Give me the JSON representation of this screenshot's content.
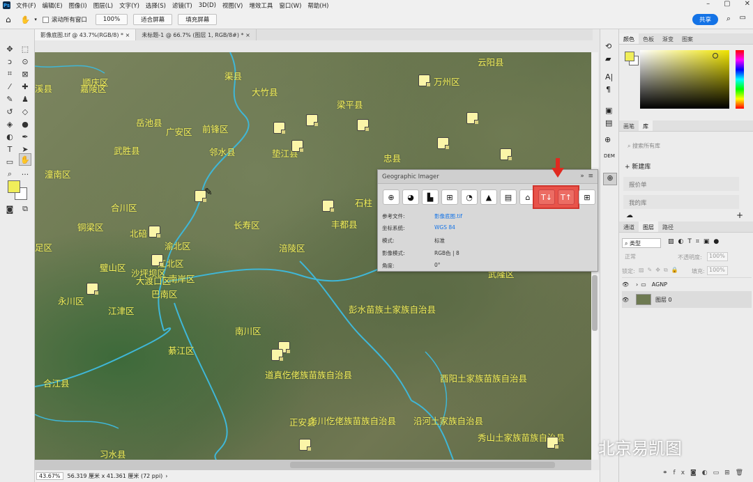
{
  "menubar": {
    "app_icon": "Ps",
    "items": [
      "文件(F)",
      "编辑(E)",
      "图像(I)",
      "图层(L)",
      "文字(Y)",
      "选择(S)",
      "滤镜(T)",
      "3D(D)",
      "视图(V)",
      "增效工具",
      "窗口(W)",
      "帮助(H)"
    ]
  },
  "options_bar": {
    "scroll_all_label": "滚动所有窗口",
    "zoom_100": "100%",
    "fit_screen": "适合屏幕",
    "fill_screen": "填充屏幕",
    "share": "共享"
  },
  "tabs": [
    {
      "label": "影像底图.tif @ 43.7%(RGB/8) *"
    },
    {
      "label": "未标题-1 @ 66.7% (图层 1, RGB/8#) *"
    }
  ],
  "map": {
    "labels": [
      {
        "text": "渠县"
      },
      {
        "text": "云阳县"
      },
      {
        "text": "顺庆区"
      },
      {
        "text": "嘉陵区"
      },
      {
        "text": "溪县"
      },
      {
        "text": "大竹县"
      },
      {
        "text": "万州区"
      },
      {
        "text": "梁平县"
      },
      {
        "text": "岳池县"
      },
      {
        "text": "广安区"
      },
      {
        "text": "前锋区"
      },
      {
        "text": "武胜县"
      },
      {
        "text": "邻水县"
      },
      {
        "text": "垫江县"
      },
      {
        "text": "忠县"
      },
      {
        "text": "潼南区"
      },
      {
        "text": "合川区"
      },
      {
        "text": "石柱"
      },
      {
        "text": "铜梁区"
      },
      {
        "text": "北碚"
      },
      {
        "text": "长寿区"
      },
      {
        "text": "丰都县"
      },
      {
        "text": "足区"
      },
      {
        "text": "渝北区"
      },
      {
        "text": "涪陵区"
      },
      {
        "text": "璧山区"
      },
      {
        "text": "沙坪坝区"
      },
      {
        "text": "江北区"
      },
      {
        "text": "大渡口区"
      },
      {
        "text": "南岸区"
      },
      {
        "text": "武隆区"
      },
      {
        "text": "永川区"
      },
      {
        "text": "巴南区"
      },
      {
        "text": "江津区"
      },
      {
        "text": "彭水苗族土家族自治县"
      },
      {
        "text": "南川区"
      },
      {
        "text": "綦江区"
      },
      {
        "text": "道真仡佬族苗族自治县"
      },
      {
        "text": "合江县"
      },
      {
        "text": "酉阳土家族苗族自治县"
      },
      {
        "text": "正安县"
      },
      {
        "text": "务川仡佬族苗族自治县"
      },
      {
        "text": "沿河土家族自治县"
      },
      {
        "text": "秀山土家族苗族自治县"
      },
      {
        "text": "习水县"
      }
    ]
  },
  "gi_panel": {
    "title": "Geographic Imager",
    "collapse": "»",
    "menu": "≡",
    "rows": [
      {
        "label": "参考文件:",
        "value": "影像底图.tif"
      },
      {
        "label": "坐标系统:",
        "value": "WGS 84"
      },
      {
        "label": "模式:",
        "value": "标准"
      },
      {
        "label": "影像模式:",
        "value": "RGB色 | 8"
      },
      {
        "label": "角度:",
        "value": "0°"
      }
    ],
    "buttons": [
      "target-icon",
      "globe-icon",
      "histogram-icon",
      "grid-icon",
      "reproject-icon",
      "mountain-icon",
      "table-icon",
      "building-icon",
      "import-text-icon",
      "export-text-icon",
      "add-frame-icon"
    ]
  },
  "status": {
    "zoom": "43.67%",
    "dims": "56.319 厘米 x 41.361 厘米 (72 ppi)"
  },
  "right_panel": {
    "color_tabs": [
      "颜色",
      "色板",
      "渐变",
      "图案"
    ],
    "lib_tabs": [
      "画笔",
      "库"
    ],
    "lib_search": "搜索所有库",
    "new_lib": "新建库",
    "libs": [
      "报价单",
      "我的库"
    ],
    "layer_tabs": [
      "通道",
      "图层",
      "路径"
    ],
    "filter": "类型",
    "blend": "正常",
    "opacity_label": "不透明度:",
    "opacity": "100%",
    "lock_label": "锁定:",
    "fill_label": "填充:",
    "fill": "100%",
    "layers": [
      {
        "name": "AGNP",
        "type": "group"
      },
      {
        "name": "图层 0",
        "type": "image"
      }
    ]
  },
  "watermark": "北京易凯图",
  "colors": {
    "accent": "#1473e6",
    "label": "#f3ef5a",
    "highlight": "#e8534a",
    "foreground": "#f0ee5a"
  }
}
